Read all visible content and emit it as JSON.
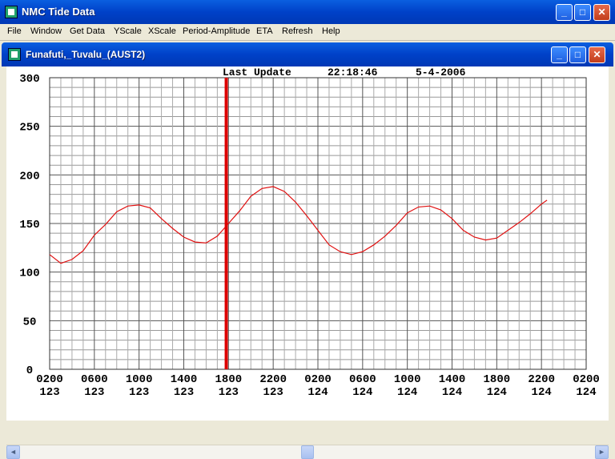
{
  "app": {
    "title": "NMC Tide Data",
    "minimize": "_",
    "maximize": "□",
    "close": "✕"
  },
  "menu": {
    "items": [
      "File",
      "Window",
      "Get Data",
      "YScale",
      "XScale",
      "Period-Amplitude",
      "ETA",
      "Refresh",
      "Help"
    ]
  },
  "child": {
    "title": "Funafuti,_Tuvalu_(AUST2)",
    "minimize": "_",
    "maximize": "□",
    "close": "✕"
  },
  "header": {
    "label": "Last Update",
    "time": "22:18:46",
    "date": "5-4-2006"
  },
  "scroll": {
    "left": "◄",
    "right": "►"
  },
  "chart_data": {
    "type": "line",
    "ylim": [
      0,
      300
    ],
    "yticks": [
      0,
      50,
      100,
      150,
      200,
      250,
      300
    ],
    "xlim": [
      2,
      50
    ],
    "xticks": [
      {
        "time": "0200",
        "day": "123",
        "h": 2
      },
      {
        "time": "0600",
        "day": "123",
        "h": 6
      },
      {
        "time": "1000",
        "day": "123",
        "h": 10
      },
      {
        "time": "1400",
        "day": "123",
        "h": 14
      },
      {
        "time": "1800",
        "day": "123",
        "h": 18
      },
      {
        "time": "2200",
        "day": "123",
        "h": 22
      },
      {
        "time": "0200",
        "day": "124",
        "h": 26
      },
      {
        "time": "0600",
        "day": "124",
        "h": 30
      },
      {
        "time": "1000",
        "day": "124",
        "h": 34
      },
      {
        "time": "1400",
        "day": "124",
        "h": 38
      },
      {
        "time": "1800",
        "day": "124",
        "h": 42
      },
      {
        "time": "2200",
        "day": "124",
        "h": 46
      },
      {
        "time": "0200",
        "day": "124",
        "h": 50
      }
    ],
    "marker_h": 17.8,
    "line_color": "#e01010",
    "marker_color": "#dd0000",
    "grid": true,
    "series": [
      {
        "values": [
          [
            2,
            118
          ],
          [
            3,
            109
          ],
          [
            4,
            113
          ],
          [
            5,
            122
          ],
          [
            6,
            138
          ],
          [
            7,
            149
          ],
          [
            8,
            162
          ],
          [
            9,
            168
          ],
          [
            10,
            169
          ],
          [
            11,
            166
          ],
          [
            12,
            155
          ],
          [
            13,
            145
          ],
          [
            14,
            136
          ],
          [
            15,
            131
          ],
          [
            16,
            130
          ],
          [
            17,
            137
          ],
          [
            18,
            150
          ],
          [
            19,
            163
          ],
          [
            20,
            178
          ],
          [
            21,
            186
          ],
          [
            22,
            188
          ],
          [
            23,
            183
          ],
          [
            24,
            172
          ],
          [
            25,
            158
          ],
          [
            26,
            143
          ],
          [
            27,
            128
          ],
          [
            28,
            121
          ],
          [
            29,
            118
          ],
          [
            30,
            121
          ],
          [
            31,
            128
          ],
          [
            32,
            137
          ],
          [
            33,
            148
          ],
          [
            34,
            161
          ],
          [
            35,
            167
          ],
          [
            36,
            168
          ],
          [
            37,
            164
          ],
          [
            38,
            155
          ],
          [
            39,
            143
          ],
          [
            40,
            136
          ],
          [
            41,
            133
          ],
          [
            42,
            135
          ],
          [
            43,
            143
          ],
          [
            44,
            151
          ],
          [
            45,
            160
          ],
          [
            46,
            170
          ],
          [
            46.5,
            174
          ]
        ]
      }
    ]
  }
}
